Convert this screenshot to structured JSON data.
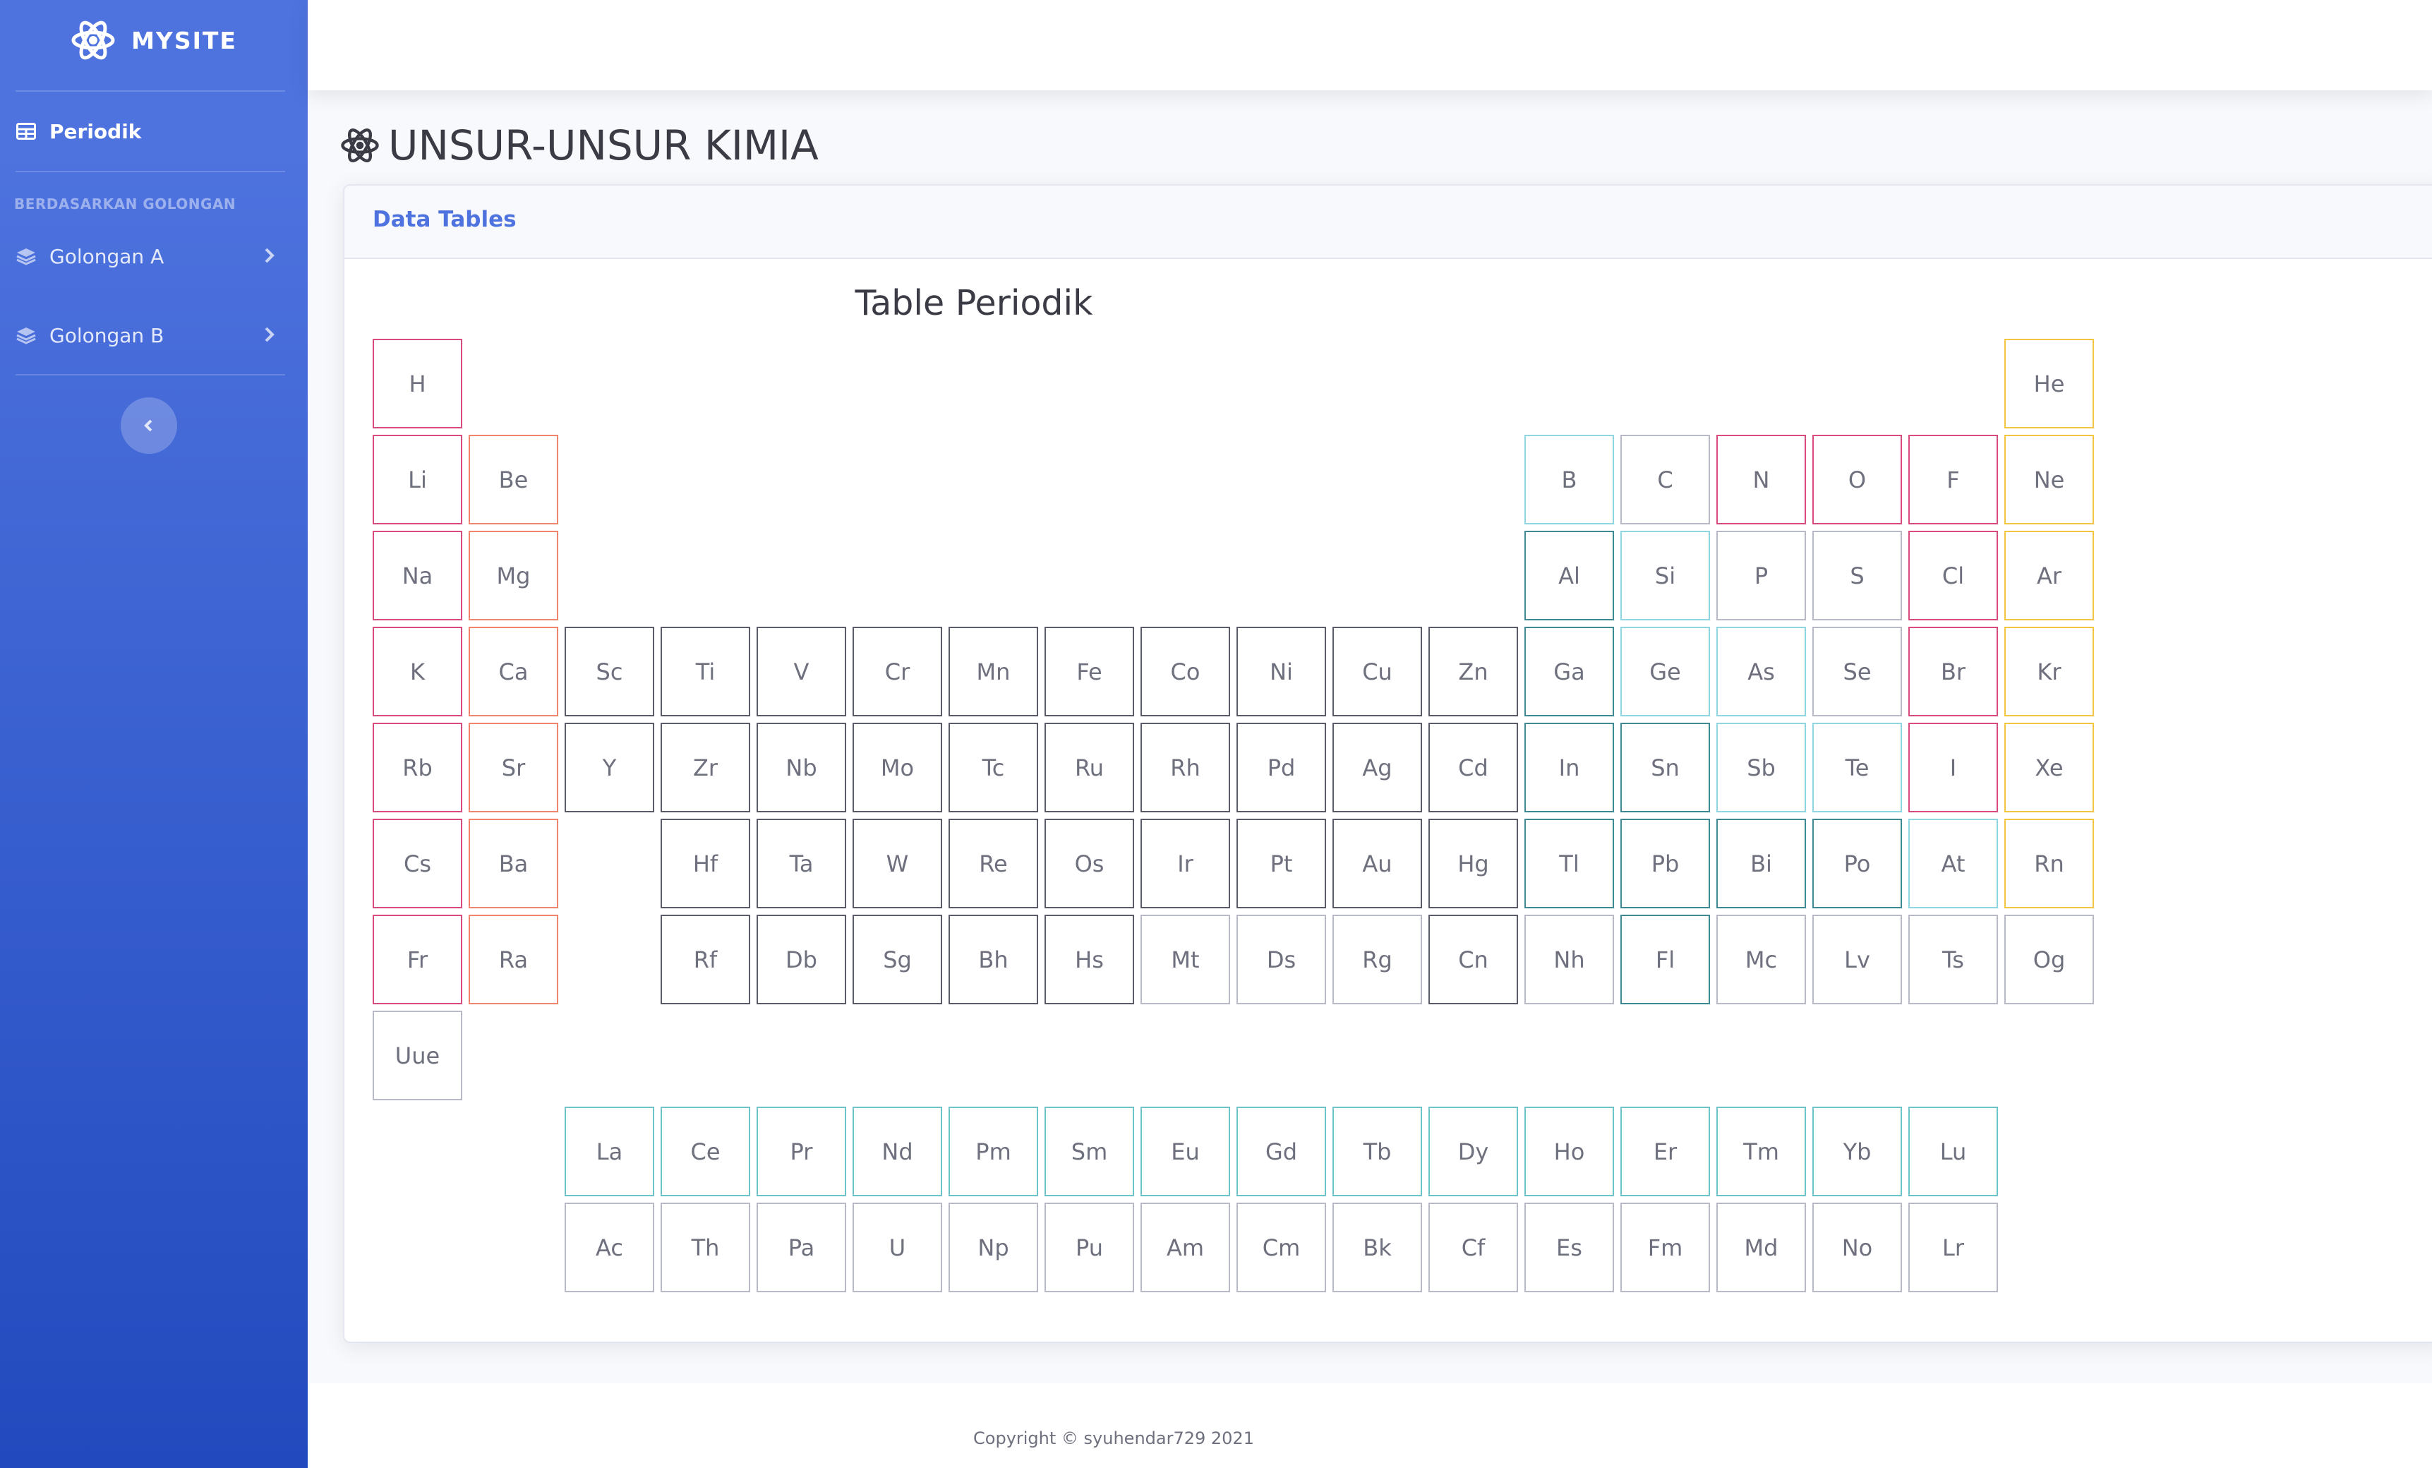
{
  "sidebar": {
    "brand": "MYSITE",
    "nav_active": "Periodik",
    "heading": "BERDASARKAN GOLONGAN",
    "items": [
      {
        "label": "Golongan A"
      },
      {
        "label": "Golongan B"
      }
    ],
    "colors": {
      "gradient_top": "#4e73df",
      "gradient_bottom": "#224abe"
    }
  },
  "page": {
    "title": "UNSUR-UNSUR KIMIA"
  },
  "card": {
    "header": "Data Tables",
    "table_title": "Table Periodik"
  },
  "footer": {
    "copyright": "Copyright © syuhendar729 2021"
  },
  "element_colors": {
    "alkali": "#d94a7e",
    "alkaline": "#f0856a",
    "transition": "#5a5c69",
    "metalloid": "#8fd7e0",
    "nonmetal": "#d94a7e",
    "halogen": "#d94a7e",
    "noble": "#f4c542",
    "post_transition": "#3d8a93",
    "lanthanide": "#6cc4c8",
    "unknown": "#b7b9c6",
    "nonmetal_grey": "#b7b9c6"
  },
  "elements": [
    {
      "symbol": "H",
      "period": 1,
      "group": 1,
      "cat": "alkali"
    },
    {
      "symbol": "He",
      "period": 1,
      "group": 18,
      "cat": "noble"
    },
    {
      "symbol": "Li",
      "period": 2,
      "group": 1,
      "cat": "alkali"
    },
    {
      "symbol": "Be",
      "period": 2,
      "group": 2,
      "cat": "alkaline"
    },
    {
      "symbol": "B",
      "period": 2,
      "group": 13,
      "cat": "metalloid"
    },
    {
      "symbol": "C",
      "period": 2,
      "group": 14,
      "cat": "nonmetal_grey"
    },
    {
      "symbol": "N",
      "period": 2,
      "group": 15,
      "cat": "nonmetal"
    },
    {
      "symbol": "O",
      "period": 2,
      "group": 16,
      "cat": "nonmetal"
    },
    {
      "symbol": "F",
      "period": 2,
      "group": 17,
      "cat": "halogen"
    },
    {
      "symbol": "Ne",
      "period": 2,
      "group": 18,
      "cat": "noble"
    },
    {
      "symbol": "Na",
      "period": 3,
      "group": 1,
      "cat": "alkali"
    },
    {
      "symbol": "Mg",
      "period": 3,
      "group": 2,
      "cat": "alkaline"
    },
    {
      "symbol": "Al",
      "period": 3,
      "group": 13,
      "cat": "post_transition"
    },
    {
      "symbol": "Si",
      "period": 3,
      "group": 14,
      "cat": "metalloid"
    },
    {
      "symbol": "P",
      "period": 3,
      "group": 15,
      "cat": "nonmetal_grey"
    },
    {
      "symbol": "S",
      "period": 3,
      "group": 16,
      "cat": "nonmetal_grey"
    },
    {
      "symbol": "Cl",
      "period": 3,
      "group": 17,
      "cat": "halogen"
    },
    {
      "symbol": "Ar",
      "period": 3,
      "group": 18,
      "cat": "noble"
    },
    {
      "symbol": "K",
      "period": 4,
      "group": 1,
      "cat": "alkali"
    },
    {
      "symbol": "Ca",
      "period": 4,
      "group": 2,
      "cat": "alkaline"
    },
    {
      "symbol": "Sc",
      "period": 4,
      "group": 3,
      "cat": "transition"
    },
    {
      "symbol": "Ti",
      "period": 4,
      "group": 4,
      "cat": "transition"
    },
    {
      "symbol": "V",
      "period": 4,
      "group": 5,
      "cat": "transition"
    },
    {
      "symbol": "Cr",
      "period": 4,
      "group": 6,
      "cat": "transition"
    },
    {
      "symbol": "Mn",
      "period": 4,
      "group": 7,
      "cat": "transition"
    },
    {
      "symbol": "Fe",
      "period": 4,
      "group": 8,
      "cat": "transition"
    },
    {
      "symbol": "Co",
      "period": 4,
      "group": 9,
      "cat": "transition"
    },
    {
      "symbol": "Ni",
      "period": 4,
      "group": 10,
      "cat": "transition"
    },
    {
      "symbol": "Cu",
      "period": 4,
      "group": 11,
      "cat": "transition"
    },
    {
      "symbol": "Zn",
      "period": 4,
      "group": 12,
      "cat": "transition"
    },
    {
      "symbol": "Ga",
      "period": 4,
      "group": 13,
      "cat": "post_transition"
    },
    {
      "symbol": "Ge",
      "period": 4,
      "group": 14,
      "cat": "metalloid"
    },
    {
      "symbol": "As",
      "period": 4,
      "group": 15,
      "cat": "metalloid"
    },
    {
      "symbol": "Se",
      "period": 4,
      "group": 16,
      "cat": "nonmetal_grey"
    },
    {
      "symbol": "Br",
      "period": 4,
      "group": 17,
      "cat": "halogen"
    },
    {
      "symbol": "Kr",
      "period": 4,
      "group": 18,
      "cat": "noble"
    },
    {
      "symbol": "Rb",
      "period": 5,
      "group": 1,
      "cat": "alkali"
    },
    {
      "symbol": "Sr",
      "period": 5,
      "group": 2,
      "cat": "alkaline"
    },
    {
      "symbol": "Y",
      "period": 5,
      "group": 3,
      "cat": "transition"
    },
    {
      "symbol": "Zr",
      "period": 5,
      "group": 4,
      "cat": "transition"
    },
    {
      "symbol": "Nb",
      "period": 5,
      "group": 5,
      "cat": "transition"
    },
    {
      "symbol": "Mo",
      "period": 5,
      "group": 6,
      "cat": "transition"
    },
    {
      "symbol": "Tc",
      "period": 5,
      "group": 7,
      "cat": "transition"
    },
    {
      "symbol": "Ru",
      "period": 5,
      "group": 8,
      "cat": "transition"
    },
    {
      "symbol": "Rh",
      "period": 5,
      "group": 9,
      "cat": "transition"
    },
    {
      "symbol": "Pd",
      "period": 5,
      "group": 10,
      "cat": "transition"
    },
    {
      "symbol": "Ag",
      "period": 5,
      "group": 11,
      "cat": "transition"
    },
    {
      "symbol": "Cd",
      "period": 5,
      "group": 12,
      "cat": "transition"
    },
    {
      "symbol": "In",
      "period": 5,
      "group": 13,
      "cat": "post_transition"
    },
    {
      "symbol": "Sn",
      "period": 5,
      "group": 14,
      "cat": "post_transition"
    },
    {
      "symbol": "Sb",
      "period": 5,
      "group": 15,
      "cat": "metalloid"
    },
    {
      "symbol": "Te",
      "period": 5,
      "group": 16,
      "cat": "metalloid"
    },
    {
      "symbol": "I",
      "period": 5,
      "group": 17,
      "cat": "halogen"
    },
    {
      "symbol": "Xe",
      "period": 5,
      "group": 18,
      "cat": "noble"
    },
    {
      "symbol": "Cs",
      "period": 6,
      "group": 1,
      "cat": "alkali"
    },
    {
      "symbol": "Ba",
      "period": 6,
      "group": 2,
      "cat": "alkaline"
    },
    {
      "symbol": "Hf",
      "period": 6,
      "group": 4,
      "cat": "transition"
    },
    {
      "symbol": "Ta",
      "period": 6,
      "group": 5,
      "cat": "transition"
    },
    {
      "symbol": "W",
      "period": 6,
      "group": 6,
      "cat": "transition"
    },
    {
      "symbol": "Re",
      "period": 6,
      "group": 7,
      "cat": "transition"
    },
    {
      "symbol": "Os",
      "period": 6,
      "group": 8,
      "cat": "transition"
    },
    {
      "symbol": "Ir",
      "period": 6,
      "group": 9,
      "cat": "transition"
    },
    {
      "symbol": "Pt",
      "period": 6,
      "group": 10,
      "cat": "transition"
    },
    {
      "symbol": "Au",
      "period": 6,
      "group": 11,
      "cat": "transition"
    },
    {
      "symbol": "Hg",
      "period": 6,
      "group": 12,
      "cat": "transition"
    },
    {
      "symbol": "Tl",
      "period": 6,
      "group": 13,
      "cat": "post_transition"
    },
    {
      "symbol": "Pb",
      "period": 6,
      "group": 14,
      "cat": "post_transition"
    },
    {
      "symbol": "Bi",
      "period": 6,
      "group": 15,
      "cat": "post_transition"
    },
    {
      "symbol": "Po",
      "period": 6,
      "group": 16,
      "cat": "post_transition"
    },
    {
      "symbol": "At",
      "period": 6,
      "group": 17,
      "cat": "metalloid"
    },
    {
      "symbol": "Rn",
      "period": 6,
      "group": 18,
      "cat": "noble"
    },
    {
      "symbol": "Fr",
      "period": 7,
      "group": 1,
      "cat": "alkali"
    },
    {
      "symbol": "Ra",
      "period": 7,
      "group": 2,
      "cat": "alkaline"
    },
    {
      "symbol": "Rf",
      "period": 7,
      "group": 4,
      "cat": "transition"
    },
    {
      "symbol": "Db",
      "period": 7,
      "group": 5,
      "cat": "transition"
    },
    {
      "symbol": "Sg",
      "period": 7,
      "group": 6,
      "cat": "transition"
    },
    {
      "symbol": "Bh",
      "period": 7,
      "group": 7,
      "cat": "transition"
    },
    {
      "symbol": "Hs",
      "period": 7,
      "group": 8,
      "cat": "transition"
    },
    {
      "symbol": "Mt",
      "period": 7,
      "group": 9,
      "cat": "unknown"
    },
    {
      "symbol": "Ds",
      "period": 7,
      "group": 10,
      "cat": "unknown"
    },
    {
      "symbol": "Rg",
      "period": 7,
      "group": 11,
      "cat": "unknown"
    },
    {
      "symbol": "Cn",
      "period": 7,
      "group": 12,
      "cat": "transition"
    },
    {
      "symbol": "Nh",
      "period": 7,
      "group": 13,
      "cat": "unknown"
    },
    {
      "symbol": "Fl",
      "period": 7,
      "group": 14,
      "cat": "post_transition"
    },
    {
      "symbol": "Mc",
      "period": 7,
      "group": 15,
      "cat": "unknown"
    },
    {
      "symbol": "Lv",
      "period": 7,
      "group": 16,
      "cat": "unknown"
    },
    {
      "symbol": "Ts",
      "period": 7,
      "group": 17,
      "cat": "unknown"
    },
    {
      "symbol": "Og",
      "period": 7,
      "group": 18,
      "cat": "unknown"
    },
    {
      "symbol": "Uue",
      "period": 8,
      "group": 1,
      "cat": "unknown"
    },
    {
      "symbol": "La",
      "period": 9,
      "group": 3,
      "cat": "lanthanide"
    },
    {
      "symbol": "Ce",
      "period": 9,
      "group": 4,
      "cat": "lanthanide"
    },
    {
      "symbol": "Pr",
      "period": 9,
      "group": 5,
      "cat": "lanthanide"
    },
    {
      "symbol": "Nd",
      "period": 9,
      "group": 6,
      "cat": "lanthanide"
    },
    {
      "symbol": "Pm",
      "period": 9,
      "group": 7,
      "cat": "lanthanide"
    },
    {
      "symbol": "Sm",
      "period": 9,
      "group": 8,
      "cat": "lanthanide"
    },
    {
      "symbol": "Eu",
      "period": 9,
      "group": 9,
      "cat": "lanthanide"
    },
    {
      "symbol": "Gd",
      "period": 9,
      "group": 10,
      "cat": "lanthanide"
    },
    {
      "symbol": "Tb",
      "period": 9,
      "group": 11,
      "cat": "lanthanide"
    },
    {
      "symbol": "Dy",
      "period": 9,
      "group": 12,
      "cat": "lanthanide"
    },
    {
      "symbol": "Ho",
      "period": 9,
      "group": 13,
      "cat": "lanthanide"
    },
    {
      "symbol": "Er",
      "period": 9,
      "group": 14,
      "cat": "lanthanide"
    },
    {
      "symbol": "Tm",
      "period": 9,
      "group": 15,
      "cat": "lanthanide"
    },
    {
      "symbol": "Yb",
      "period": 9,
      "group": 16,
      "cat": "lanthanide"
    },
    {
      "symbol": "Lu",
      "period": 9,
      "group": 17,
      "cat": "lanthanide"
    },
    {
      "symbol": "Ac",
      "period": 10,
      "group": 3,
      "cat": "unknown"
    },
    {
      "symbol": "Th",
      "period": 10,
      "group": 4,
      "cat": "unknown"
    },
    {
      "symbol": "Pa",
      "period": 10,
      "group": 5,
      "cat": "unknown"
    },
    {
      "symbol": "U",
      "period": 10,
      "group": 6,
      "cat": "unknown"
    },
    {
      "symbol": "Np",
      "period": 10,
      "group": 7,
      "cat": "unknown"
    },
    {
      "symbol": "Pu",
      "period": 10,
      "group": 8,
      "cat": "unknown"
    },
    {
      "symbol": "Am",
      "period": 10,
      "group": 9,
      "cat": "unknown"
    },
    {
      "symbol": "Cm",
      "period": 10,
      "group": 10,
      "cat": "unknown"
    },
    {
      "symbol": "Bk",
      "period": 10,
      "group": 11,
      "cat": "unknown"
    },
    {
      "symbol": "Cf",
      "period": 10,
      "group": 12,
      "cat": "unknown"
    },
    {
      "symbol": "Es",
      "period": 10,
      "group": 13,
      "cat": "unknown"
    },
    {
      "symbol": "Fm",
      "period": 10,
      "group": 14,
      "cat": "unknown"
    },
    {
      "symbol": "Md",
      "period": 10,
      "group": 15,
      "cat": "unknown"
    },
    {
      "symbol": "No",
      "period": 10,
      "group": 16,
      "cat": "unknown"
    },
    {
      "symbol": "Lr",
      "period": 10,
      "group": 17,
      "cat": "unknown"
    }
  ]
}
